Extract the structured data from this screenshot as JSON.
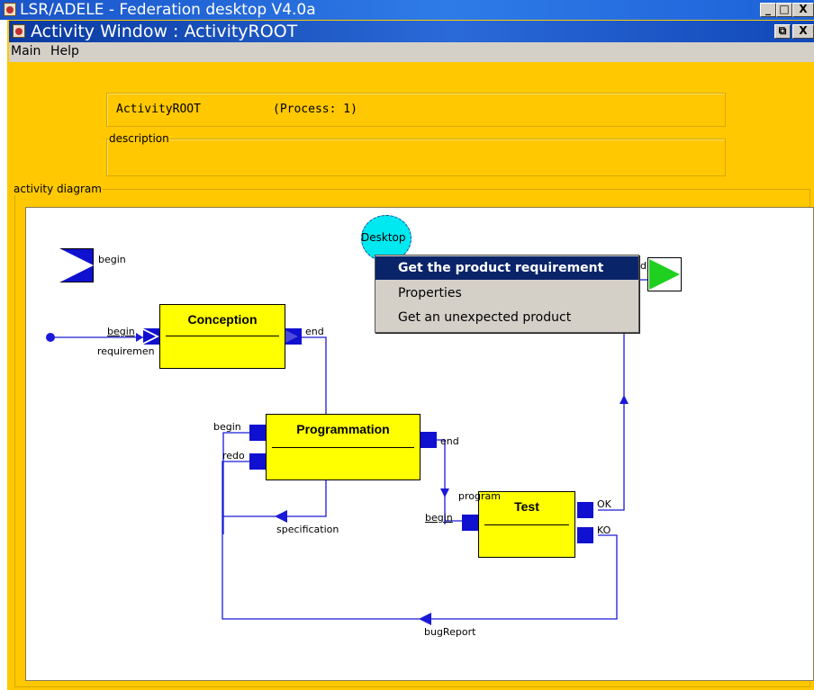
{
  "app": {
    "title": "LSR/ADELE - Federation desktop V4.0a"
  },
  "outer_controls": {
    "minimize": "_",
    "restore": "□",
    "close": "X"
  },
  "window": {
    "title": "Activity Window : ActivityROOT"
  },
  "inner_controls": {
    "restore": "⧉",
    "close": "X"
  },
  "menu": {
    "items": [
      "Main",
      "Help"
    ]
  },
  "header": {
    "activity_name": "ActivityROOT",
    "process_info": "(Process: 1)",
    "description_label": "description",
    "description_value": ""
  },
  "diagram": {
    "group_label": "activity diagram",
    "begin_port_label": "begin",
    "desktop_label": "Desktop",
    "end_port_fragment": "d",
    "activities": [
      {
        "name": "Conception",
        "in_ports": [
          "begin"
        ],
        "in_sub": "requiremen",
        "out_ports": [
          "end"
        ]
      },
      {
        "name": "Programmation",
        "in_ports": [
          "begin",
          "redo"
        ],
        "out_ports": [
          "end"
        ]
      },
      {
        "name": "Test",
        "in_ports": [
          "begin"
        ],
        "in_top": "program",
        "out_ports": [
          "OK",
          "KO"
        ]
      }
    ],
    "flow_labels": {
      "specification": "specification",
      "bug_report": "bugReport"
    }
  },
  "context_menu": {
    "items": [
      "Get the product requirement",
      "Properties",
      "Get an unexpected product"
    ],
    "selected_index": 0
  },
  "colors": {
    "title_blue": "#2e7be8",
    "panel_yellow": "#ffc800",
    "activity_yellow": "#ffff00",
    "port_blue": "#1010d0",
    "desktop_cyan": "#00e8f0",
    "end_green": "#20d020",
    "menu_highlight": "#0a246a"
  }
}
